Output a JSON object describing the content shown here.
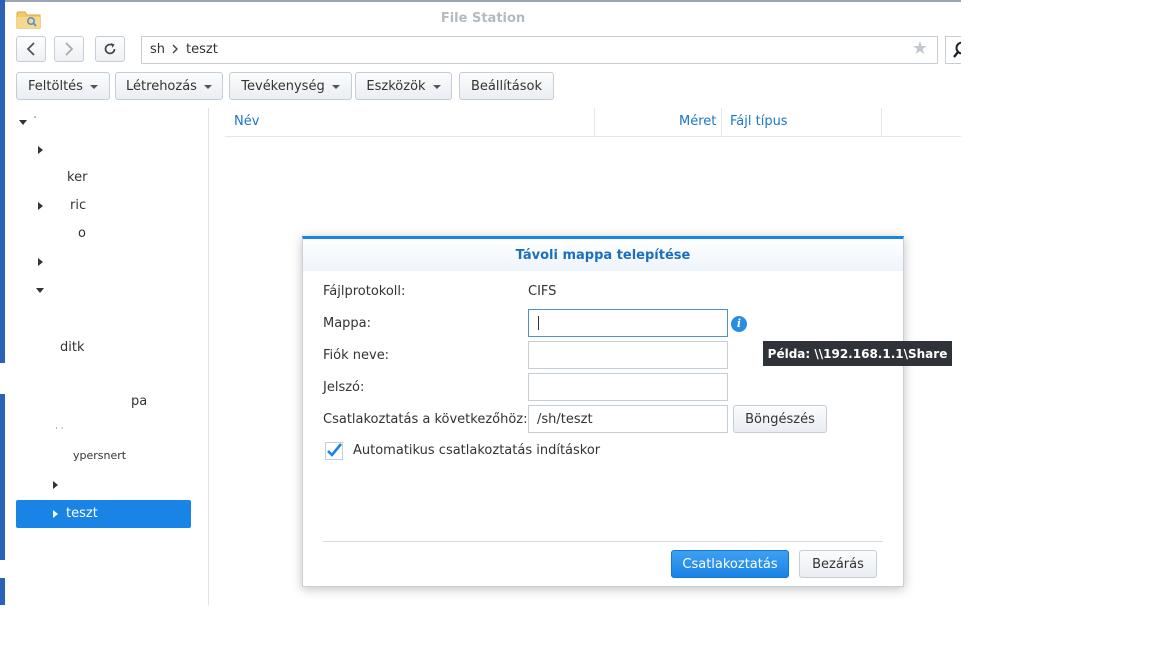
{
  "window": {
    "title": "File Station",
    "app_icon": "folder-search-icon"
  },
  "nav": {
    "back_icon": "chevron-left-icon",
    "forward_icon": "chevron-right-icon",
    "refresh_icon": "refresh-icon",
    "path": [
      "sh",
      "teszt"
    ],
    "favorite_icon": "star-icon",
    "search_icon": "search-icon"
  },
  "toolbar": {
    "upload": "Feltöltés",
    "create": "Létrehozás",
    "action": "Tevékenység",
    "tools": "Eszközök",
    "settings": "Beállítások"
  },
  "columns": {
    "name": "Név",
    "size": "Méret",
    "type": "Fájl típus"
  },
  "tree": {
    "items": [
      "ker",
      "ric",
      "o",
      "ditk",
      "pa",
      "ypersnert"
    ],
    "selected": "teszt"
  },
  "dialog": {
    "title": "Távoli mappa telepítése",
    "protocol_label": "Fájlprotokoll:",
    "protocol_value": "CIFS",
    "folder_label": "Mappa:",
    "folder_value": "",
    "account_label": "Fiók neve:",
    "account_value": "",
    "password_label": "Jelszó:",
    "password_value": "",
    "mount_label": "Csatlakoztatás a következőhöz:",
    "mount_value": "/sh/teszt",
    "browse_button": "Böngészés",
    "auto_mount_label": "Automatikus csatlakoztatás indításkor",
    "auto_mount_checked": true,
    "connect_button": "Csatlakoztatás",
    "close_button": "Bezárás",
    "info_icon": "info-icon"
  },
  "tooltip": {
    "text": "Példa: \\\\192.168.1.1\\Share"
  },
  "colors": {
    "accent": "#1a83e6",
    "sidebar_edge": "#2a62b8",
    "header_link": "#1a76c9"
  }
}
